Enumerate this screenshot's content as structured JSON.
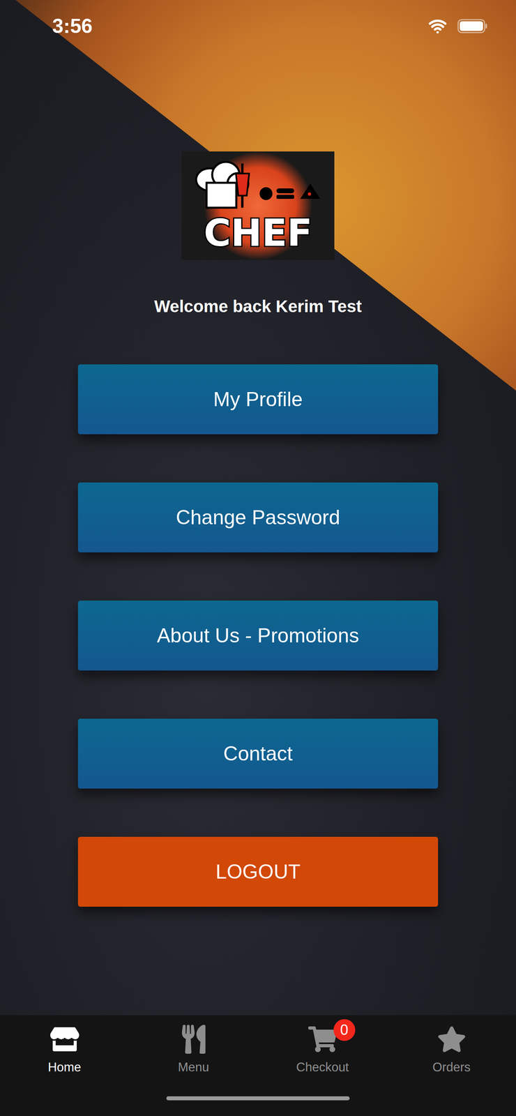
{
  "status_bar": {
    "time": "3:56"
  },
  "logo": {
    "text": "CHEF"
  },
  "welcome": "Welcome back Kerim Test",
  "menu_buttons": [
    {
      "label": "My Profile",
      "kind": "primary"
    },
    {
      "label": "Change Password",
      "kind": "primary"
    },
    {
      "label": "About Us - Promotions",
      "kind": "primary"
    },
    {
      "label": "Contact",
      "kind": "primary"
    },
    {
      "label": "LOGOUT",
      "kind": "danger"
    }
  ],
  "tab_bar": {
    "items": [
      {
        "label": "Home",
        "selected": true,
        "badge": ""
      },
      {
        "label": "Menu",
        "selected": false,
        "badge": ""
      },
      {
        "label": "Checkout",
        "selected": false,
        "badge": "0"
      },
      {
        "label": "Orders",
        "selected": false,
        "badge": ""
      }
    ]
  }
}
